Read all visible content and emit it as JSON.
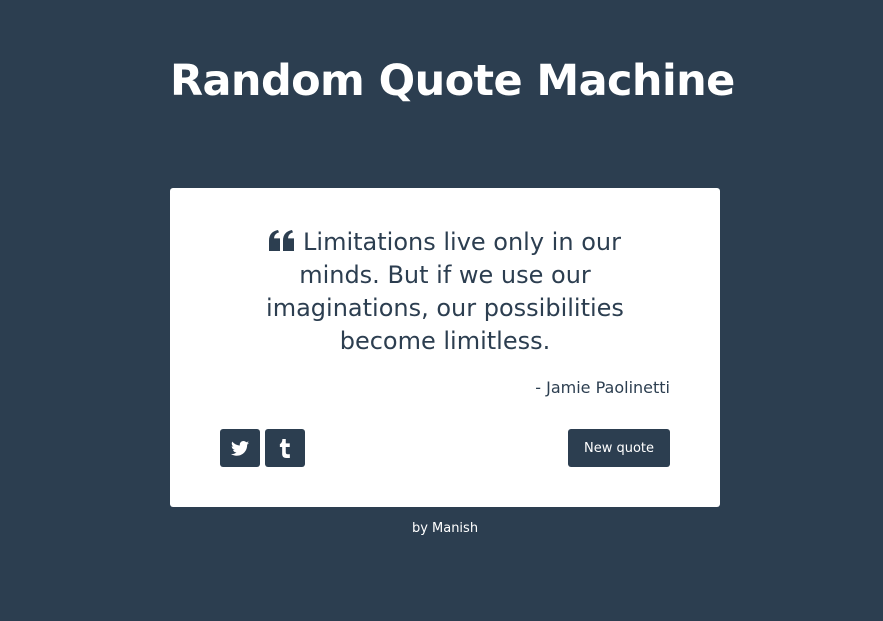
{
  "header": {
    "title": "Random Quote Machine"
  },
  "quote": {
    "text": "Limitations live only in our minds. But if we use our imaginations, our possibilities become limitless.",
    "author": "- Jamie Paolinetti",
    "icon": "quote-left-icon"
  },
  "actions": {
    "twitter_icon": "twitter-icon",
    "tumblr_icon": "tumblr-icon",
    "new_quote_label": "New quote"
  },
  "footer": {
    "credit": "by Manish"
  },
  "colors": {
    "background": "#2c3e50",
    "card": "#ffffff",
    "accent": "#2c3e50"
  }
}
